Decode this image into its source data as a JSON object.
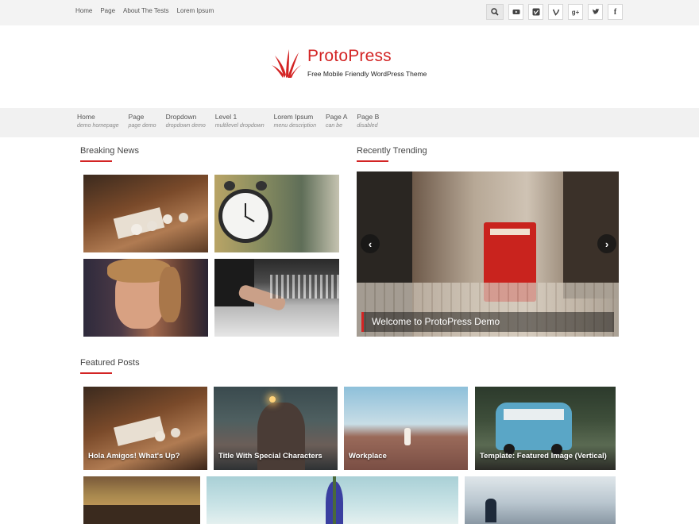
{
  "topbar": {
    "nav": [
      "Home",
      "Page",
      "About The Tests",
      "Lorem Ipsum"
    ],
    "social": [
      {
        "name": "search-icon",
        "glyph": "⌕"
      },
      {
        "name": "youtube-icon",
        "glyph": "▶"
      },
      {
        "name": "vimeo-icon",
        "glyph": "V"
      },
      {
        "name": "vine-icon",
        "glyph": "v"
      },
      {
        "name": "google-plus-icon",
        "glyph": "g+"
      },
      {
        "name": "twitter-icon",
        "glyph": "t"
      },
      {
        "name": "facebook-icon",
        "glyph": "f"
      }
    ]
  },
  "brand": {
    "title": "ProtoPress",
    "tagline": "Free Mobile Friendly WordPress Theme",
    "accent": "#d32424"
  },
  "mainnav": [
    {
      "label": "Home",
      "desc": "demo homepage"
    },
    {
      "label": "Page",
      "desc": "page demo"
    },
    {
      "label": "Dropdown",
      "desc": "dropdown demo"
    },
    {
      "label": "Level 1",
      "desc": "multilevel dropdown"
    },
    {
      "label": "Lorem Ipsum",
      "desc": "menu description"
    },
    {
      "label": "Page A",
      "desc": "can be"
    },
    {
      "label": "Page B",
      "desc": "disabled"
    }
  ],
  "sections": {
    "breaking": "Breaking News",
    "trending": "Recently Trending",
    "featured": "Featured Posts"
  },
  "slider": {
    "caption": "Welcome to ProtoPress Demo",
    "prev": "‹",
    "next": "›"
  },
  "featured": [
    {
      "title": "Hola Amigos! What's Up?"
    },
    {
      "title": "Title With Special Characters"
    },
    {
      "title": "Workplace"
    },
    {
      "title": "Template: Featured Image (Vertical)"
    }
  ]
}
